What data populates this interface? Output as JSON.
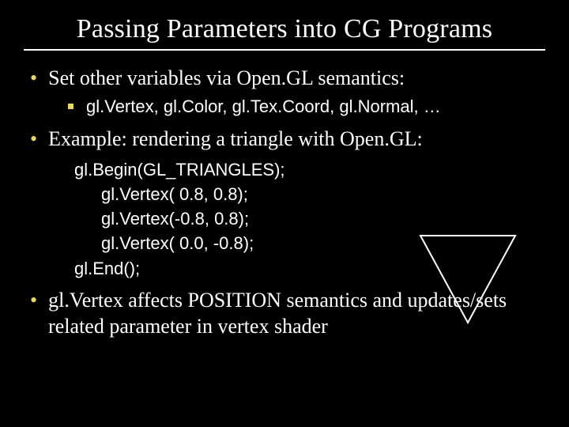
{
  "title": "Passing Parameters into CG Programs",
  "bullets": {
    "b1a": "Set other variables via Open.GL semantics:",
    "b2a": "gl.Vertex, gl.Color, gl.Tex.Coord, gl.Normal, …",
    "b1b": "Example: rendering a triangle with Open.GL:",
    "b1c": "gl.Vertex affects POSITION semantics and updates/sets related parameter in vertex shader"
  },
  "code": {
    "l1": "gl.Begin(GL_TRIANGLES);",
    "l2": "gl.Vertex( 0.8,  0.8);",
    "l3": "gl.Vertex(-0.8,  0.8);",
    "l4": "gl.Vertex( 0.0, -0.8);",
    "l5": "gl.End();"
  }
}
